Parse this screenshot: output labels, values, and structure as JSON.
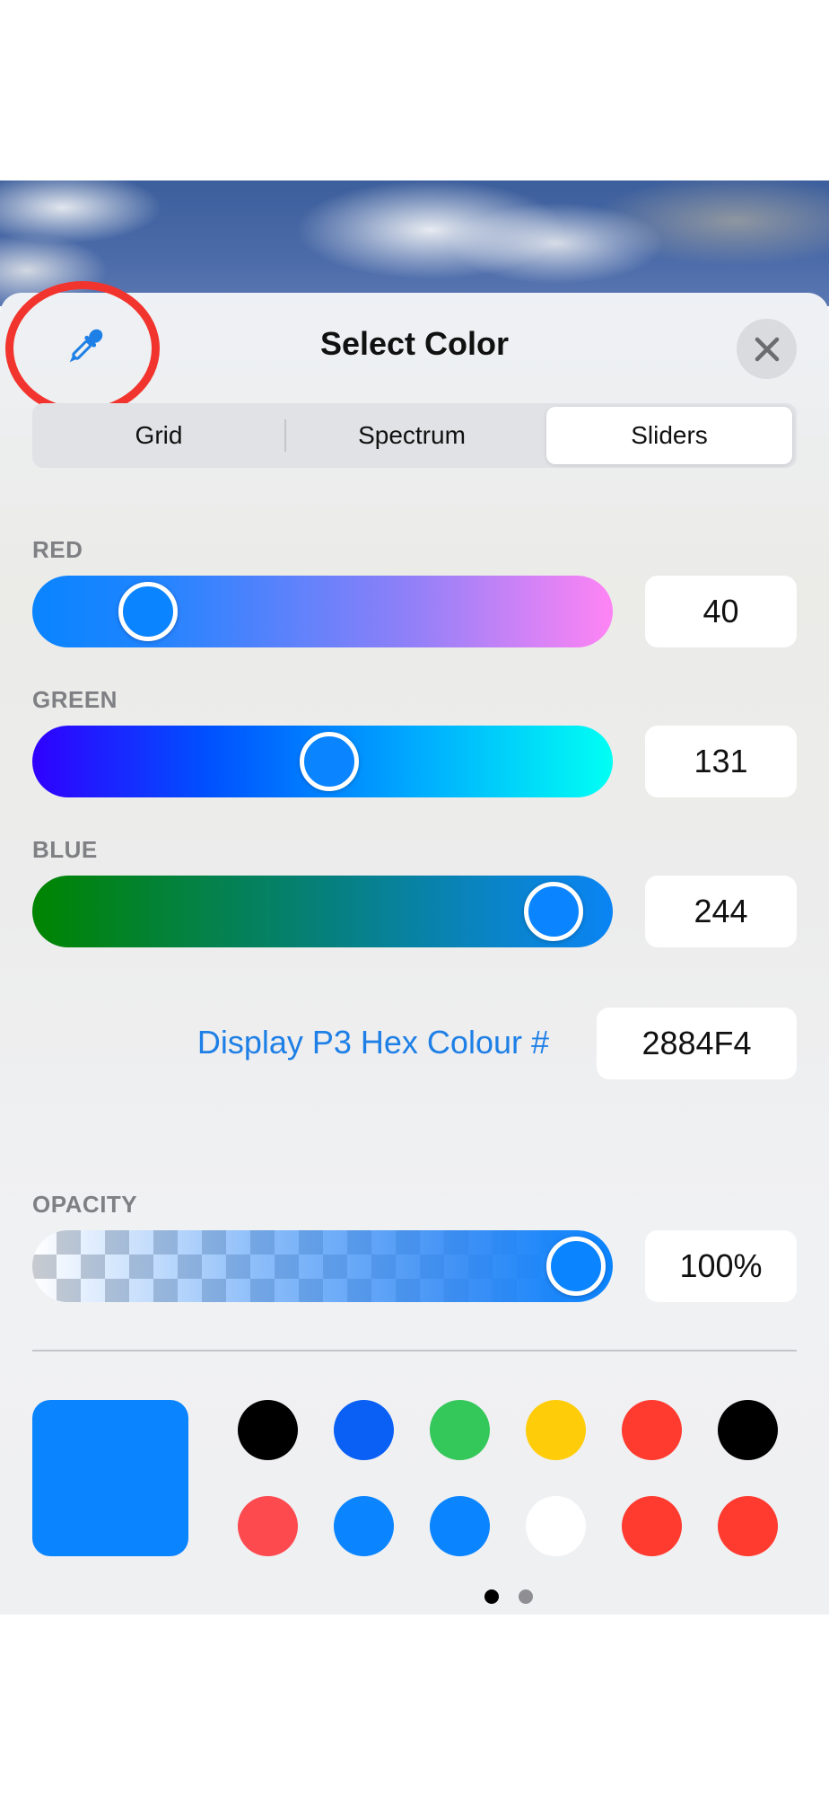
{
  "header": {
    "title": "Select Color",
    "eyedropper_icon": "eyedropper-icon",
    "close_icon": "close-icon"
  },
  "tabs": [
    {
      "label": "Grid",
      "selected": false
    },
    {
      "label": "Spectrum",
      "selected": false
    },
    {
      "label": "Sliders",
      "selected": true
    }
  ],
  "sliders": {
    "red": {
      "label": "RED",
      "value": "40"
    },
    "green": {
      "label": "GREEN",
      "value": "131"
    },
    "blue": {
      "label": "BLUE",
      "value": "244"
    }
  },
  "hex": {
    "label": "Display P3 Hex Colour #",
    "value": "2884F4"
  },
  "opacity": {
    "label": "OPACITY",
    "value": "100%"
  },
  "current_color": "#0a84ff",
  "swatches": [
    "#000000",
    "#0a5ff5",
    "#34c759",
    "#ffcc0a",
    "#ff3b30",
    "#000000",
    "#fc4a4f",
    "#0a84ff",
    "#0a84ff",
    "#ffffff",
    "#ff3b30",
    "#ff3b30"
  ],
  "pages": {
    "count": 2,
    "current": 1
  },
  "colors": {
    "accent": "#0a84ff",
    "annotation": "#f2342e",
    "hex_label": "#1e7fe6"
  }
}
